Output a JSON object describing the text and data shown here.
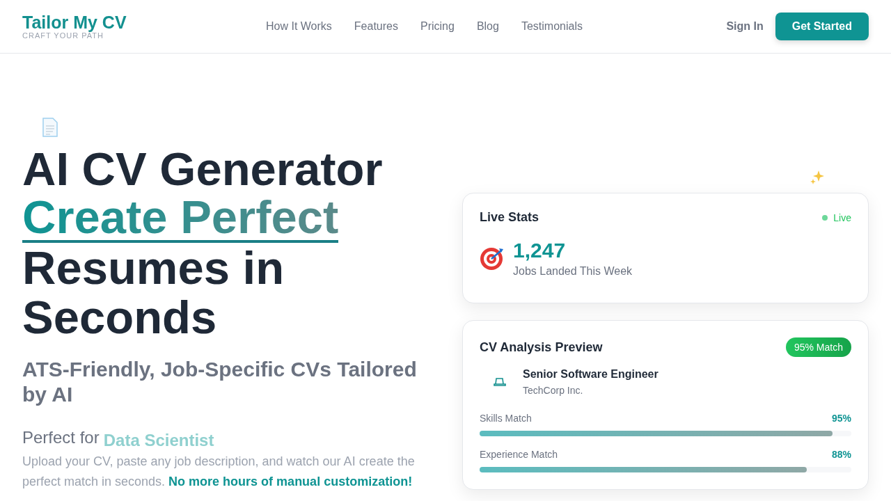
{
  "brand": {
    "name": "Tailor My CV",
    "tagline": "CRAFT YOUR PATH"
  },
  "nav": [
    "How It Works",
    "Features",
    "Pricing",
    "Blog",
    "Testimonials"
  ],
  "actions": {
    "sign_in": "Sign In",
    "get_started": "Get Started"
  },
  "hero": {
    "title": [
      {
        "text": "AI CV Generator",
        "kind": "plain"
      },
      {
        "text": "Create Perfect",
        "kind": "highlight"
      },
      {
        "text": "Resumes in Seconds",
        "kind": "plain"
      }
    ],
    "subtitle": "ATS-Friendly, Job-Specific CVs Tailored by AI",
    "perfect_for": "Perfect for",
    "role": "Data Scientist",
    "description": "Upload your CV, paste any job description, and watch our AI create the perfect match in seconds. **No more hours of manual customization!**"
  },
  "live_stats": {
    "title": "Live Stats",
    "status": "Live",
    "value": "1,247",
    "label": "Jobs Landed This Week"
  },
  "analysis": {
    "title": "CV Analysis Preview",
    "badge": "95% Match",
    "job_title": "Senior Software Engineer",
    "company": "TechCorp Inc.",
    "metrics": [
      {
        "label": "Skills Match",
        "value": "95%",
        "level": 0.95
      },
      {
        "label": "Experience Match",
        "value": "88%",
        "level": 0.88
      }
    ]
  }
}
